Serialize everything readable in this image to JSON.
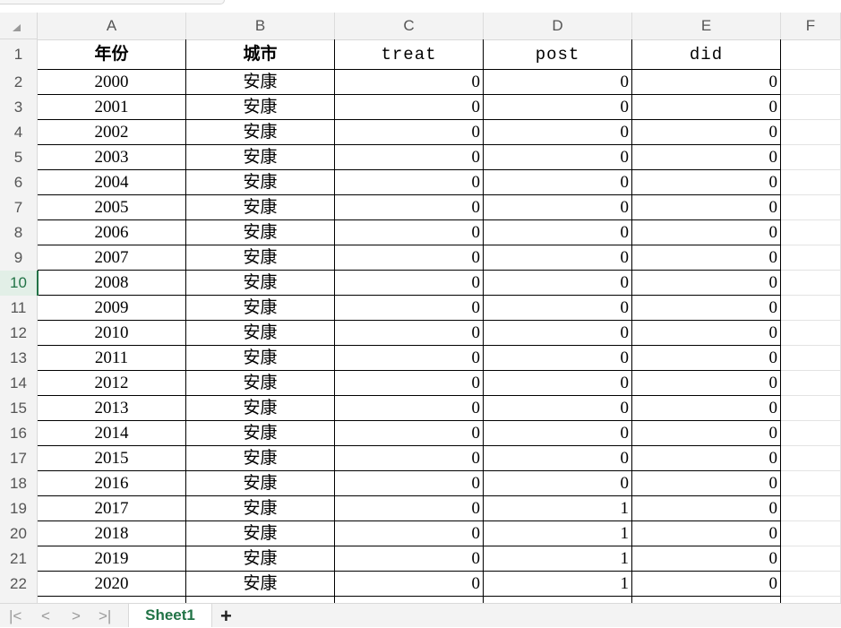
{
  "columns": [
    "A",
    "B",
    "C",
    "D",
    "E",
    "F"
  ],
  "header_row": [
    "年份",
    "城市",
    "treat",
    "post",
    "did"
  ],
  "rows": [
    [
      "2000",
      "安康",
      "0",
      "0",
      "0"
    ],
    [
      "2001",
      "安康",
      "0",
      "0",
      "0"
    ],
    [
      "2002",
      "安康",
      "0",
      "0",
      "0"
    ],
    [
      "2003",
      "安康",
      "0",
      "0",
      "0"
    ],
    [
      "2004",
      "安康",
      "0",
      "0",
      "0"
    ],
    [
      "2005",
      "安康",
      "0",
      "0",
      "0"
    ],
    [
      "2006",
      "安康",
      "0",
      "0",
      "0"
    ],
    [
      "2007",
      "安康",
      "0",
      "0",
      "0"
    ],
    [
      "2008",
      "安康",
      "0",
      "0",
      "0"
    ],
    [
      "2009",
      "安康",
      "0",
      "0",
      "0"
    ],
    [
      "2010",
      "安康",
      "0",
      "0",
      "0"
    ],
    [
      "2011",
      "安康",
      "0",
      "0",
      "0"
    ],
    [
      "2012",
      "安康",
      "0",
      "0",
      "0"
    ],
    [
      "2013",
      "安康",
      "0",
      "0",
      "0"
    ],
    [
      "2014",
      "安康",
      "0",
      "0",
      "0"
    ],
    [
      "2015",
      "安康",
      "0",
      "0",
      "0"
    ],
    [
      "2016",
      "安康",
      "0",
      "0",
      "0"
    ],
    [
      "2017",
      "安康",
      "0",
      "1",
      "0"
    ],
    [
      "2018",
      "安康",
      "0",
      "1",
      "0"
    ],
    [
      "2019",
      "安康",
      "0",
      "1",
      "0"
    ],
    [
      "2020",
      "安康",
      "0",
      "1",
      "0"
    ]
  ],
  "row_numbers": [
    "1",
    "2",
    "3",
    "4",
    "5",
    "6",
    "7",
    "8",
    "9",
    "10",
    "11",
    "12",
    "13",
    "14",
    "15",
    "16",
    "17",
    "18",
    "19",
    "20",
    "21",
    "22"
  ],
  "active_row": "10",
  "sheet_tab": "Sheet1",
  "add_tab": "+",
  "nav": {
    "first": "|<",
    "prev": "<",
    "next": ">",
    "last": ">|"
  },
  "colors": {
    "accent": "#217346"
  }
}
